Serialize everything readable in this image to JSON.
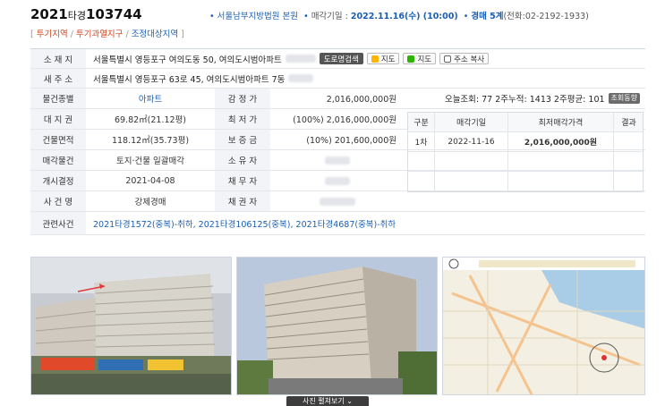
{
  "header": {
    "case_prefix": "2021",
    "case_type": "타경",
    "case_number": "103744",
    "court": "서울남부지방법원 본원",
    "auction_date_label": "매각기일 :",
    "auction_date": "2022.11.16(수) (10:00)",
    "dept": "경매 5계",
    "phone": "(전화:02-2192-1933)"
  },
  "tags": [
    "투기지역",
    "투기과열지구",
    "조정대상지역"
  ],
  "location": {
    "label": "소 재 지",
    "value": "서울특별시 영등포구 여의도동 50, 여의도시범아파트",
    "btn_road": "도로명검색",
    "btn_map1": "지도",
    "btn_map2": "지도",
    "btn_copy": "주소 복사"
  },
  "new_address": {
    "label": "새 주 소",
    "value": "서울특별시 영등포구 63로 45, 여의도시범아파트 7동"
  },
  "rows": [
    {
      "l1": "물건종별",
      "v1": "아파트",
      "l2": "감 정 가",
      "v2": "2,016,000,000원"
    },
    {
      "l1": "대 지 권",
      "v1": "69.82㎡(21.12평)",
      "l2": "최 저 가",
      "v2": "(100%) 2,016,000,000원"
    },
    {
      "l1": "건물면적",
      "v1": "118.12㎡(35.73평)",
      "l2": "보 증 금",
      "v2": "(10%) 201,600,000원"
    },
    {
      "l1": "매각물건",
      "v1": "토지·건물 일괄매각",
      "l2": "소 유 자",
      "v2": ""
    },
    {
      "l1": "개시결정",
      "v1": "2021-04-08",
      "l2": "채 무 자",
      "v2": ""
    },
    {
      "l1": "사 건 명",
      "v1": "강제경매",
      "l2": "채 권 자",
      "v2": ""
    }
  ],
  "views": {
    "text": "오늘조회: 77  2주누적: 1413  2주평균: 101",
    "button": "조회동향"
  },
  "history_table": {
    "headers": [
      "구분",
      "매각기일",
      "최저매각가격",
      "결과"
    ],
    "rows": [
      [
        "1차",
        "2022-11-16",
        "2,016,000,000원",
        ""
      ]
    ]
  },
  "related": {
    "label": "관련사건",
    "value": "2021타경1572(중복)-취하, 2021타경106125(중복), 2021타경4687(중복)-취하"
  },
  "photo_caption": "사진 펼쳐보기",
  "colors": {
    "accent": "#1a5fb4",
    "tag_red": "#d0421b",
    "label_bg": "#f2f4f7"
  }
}
